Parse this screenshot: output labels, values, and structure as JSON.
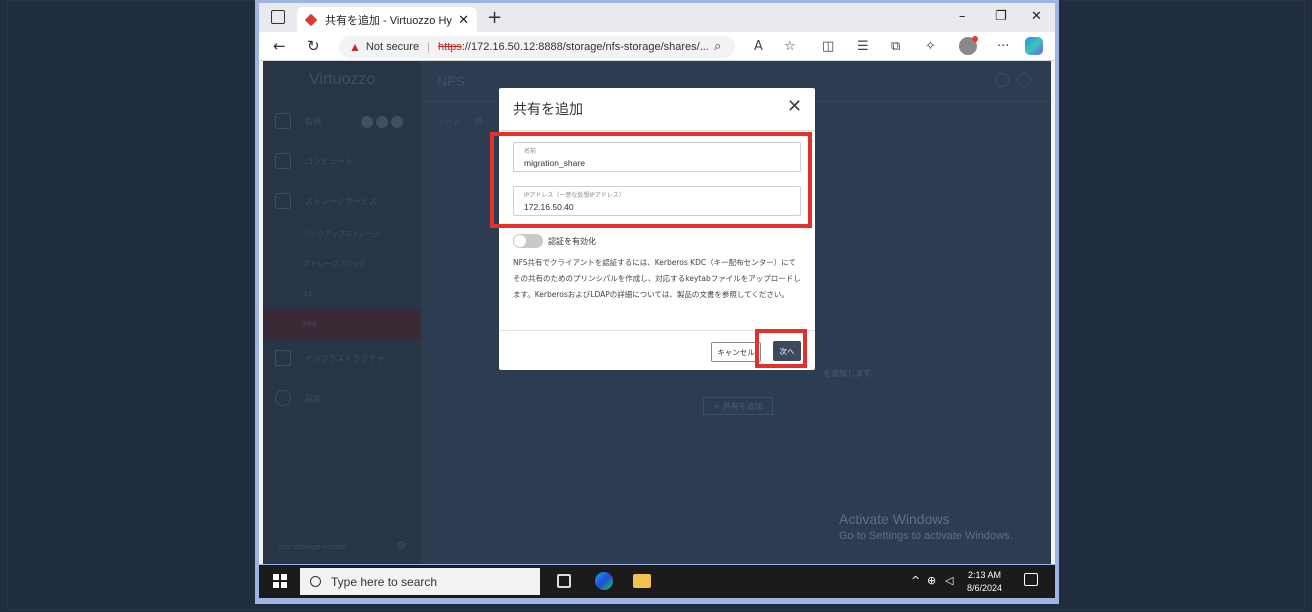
{
  "browser": {
    "tab_title": "共有を追加 - Virtuozzo Hybrid Inf",
    "security_label": "Not secure",
    "url_scheme": "https",
    "url_rest": "://172.16.50.12:8888/storage/nfs-storage/shares/...",
    "window_controls": {
      "minimize": "–",
      "restore": "❐",
      "close": "✕"
    }
  },
  "sidebar": {
    "brand": "Virtuozzo",
    "items": [
      {
        "label": "監視"
      },
      {
        "label": "コンピュート"
      },
      {
        "label": "ストレージサービス"
      },
      {
        "label": "バックアップストレージ"
      },
      {
        "label": "ストレージブロック"
      },
      {
        "label": "S3"
      },
      {
        "label": "NFS"
      },
      {
        "label": "インフラストラクチャ"
      },
      {
        "label": "設定"
      }
    ],
    "cluster_name": "poc-storage-cluster"
  },
  "main": {
    "title": "NFS",
    "tabs": [
      "ノード",
      "共"
    ],
    "empty_hint": "を追加します。",
    "add_share_button": "+ 共有を追加"
  },
  "modal": {
    "title": "共有を追加",
    "name_label": "名前",
    "name_value": "migration_share",
    "ip_label": "IPアドレス（一意な仮想IPアドレス）",
    "ip_value": "172.16.50.40",
    "toggle_label": "認証を有効化",
    "description": "NFS共有でクライアントを認証するには、Kerberos KDC（キー配布センター）にてその共有のためのプリンシパルを作成し、対応するkeytabファイルをアップロードします。KerberosおよびLDAPの詳細については、製品の文書を参照してください。",
    "cancel_label": "キャンセル",
    "next_label": "次へ"
  },
  "watermark": {
    "title": "Activate Windows",
    "subtitle": "Go to Settings to activate Windows."
  },
  "taskbar": {
    "search_placeholder": "Type here to search",
    "time": "2:13 AM",
    "date": "8/6/2024"
  },
  "colors": {
    "highlight": "#e0312a",
    "next_button": "#3b4a5c",
    "sidebar_active": "#3a2a36"
  }
}
